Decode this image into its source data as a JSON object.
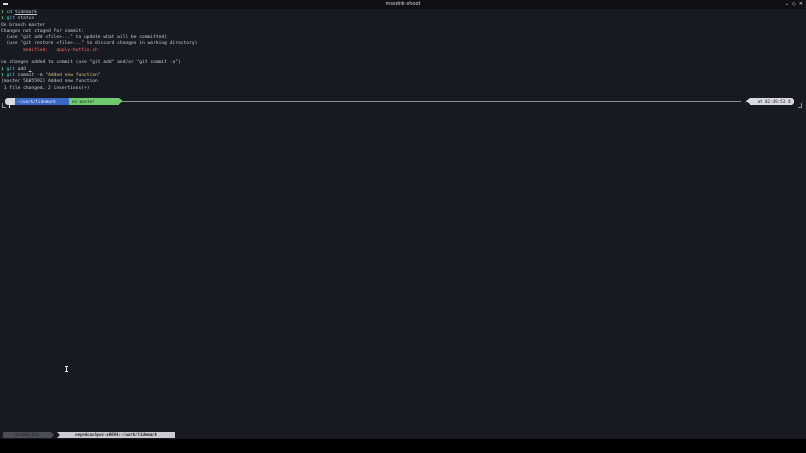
{
  "window": {
    "title": "mssdnk-shoot",
    "controls": [
      "⌄",
      "◇",
      "✕"
    ]
  },
  "terminal": {
    "lines": [
      [
        {
          "t": "❯ ",
          "c": "prompt-sym"
        },
        {
          "t": "cd ",
          "c": "cmd-cd"
        },
        {
          "t": "tidemark",
          "c": "arg-u"
        }
      ],
      [
        {
          "t": "❯ ",
          "c": "prompt-sym"
        },
        {
          "t": "git",
          "c": "cmd-git"
        },
        {
          "t": " status",
          "c": "muted"
        }
      ],
      [
        {
          "t": "On branch master",
          "c": "muted"
        }
      ],
      [
        {
          "t": "Changes not staged for commit:",
          "c": "muted"
        }
      ],
      [
        {
          "t": "  (use \"git add <file>...\" to update what will be committed)",
          "c": "muted"
        }
      ],
      [
        {
          "t": "  (use \"git restore <file>...\" to discard changes in working directory)",
          "c": "muted"
        }
      ],
      [
        {
          "t": "        modified:   apply-hotfix.sh",
          "c": "modified"
        }
      ],
      [
        {
          "t": "",
          "c": "muted"
        }
      ],
      [
        {
          "t": "no changes added to commit (use \"git add\" and/or \"git commit -a\")",
          "c": "muted"
        }
      ],
      [
        {
          "t": "❯ ",
          "c": "prompt-sym"
        },
        {
          "t": "git",
          "c": "cmd-git"
        },
        {
          "t": " add ",
          "c": "muted"
        },
        {
          "t": ".",
          "c": "arg-u"
        }
      ],
      [
        {
          "t": "❯ ",
          "c": "prompt-sym"
        },
        {
          "t": "git",
          "c": "cmd-git"
        },
        {
          "t": " commit -m ",
          "c": "muted"
        },
        {
          "t": "\"Added new function\"",
          "c": "str"
        }
      ],
      [
        {
          "t": "[master 5685592] Added new function",
          "c": "muted"
        }
      ],
      [
        {
          "t": " 1 file changed, 2 insertions(+)",
          "c": "muted"
        }
      ]
    ]
  },
  "prompt": {
    "os_icon": "",
    "directory": "~/work/tidemark",
    "git_branch": "on  master",
    "status_icon": "✓",
    "time": "at 02:49:53 ⏱"
  },
  "statusbar": {
    "session": "mssdnk-tui",
    "window": "veyndcachyos-x0084:~/work/tidemark"
  }
}
